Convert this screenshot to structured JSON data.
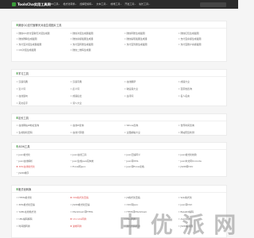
{
  "nav": {
    "logo_text": "ToolsCha实用工具网",
    "menu": [
      "JSON工具",
      "格式化转换",
      "加解密编码",
      "文本工具",
      "前端工具",
      "开发工具",
      "站长工具"
    ]
  },
  "sections": [
    {
      "title": "微信QQ支付宝聊天对话生成图片工具",
      "items": [
        "微信QQ支付宝聊天对话生成器",
        "微信对话生成器截图",
        "微信转账生成截图",
        "微信红包生成截图",
        "微信群聊生成截图",
        "微信余额截图生成器",
        "微信提现截图生成器",
        "支付宝余额生成截图",
        "支付宝对话生成器截图",
        "支付宝转账生成截图",
        "支付宝到账生成截图",
        "支付宝账户余额截图",
        "QQ对话生成截图",
        "微信二维码生成器"
      ]
    },
    {
      "title": "学习工具",
      "items": [
        "汉语词典",
        "汉语字典",
        "在线翻译",
        "成语大全",
        "近义词",
        "反义词",
        "歇后语大全",
        "百家姓查询",
        "在线造句",
        "成语接龙",
        "古诗词",
        "名人名言",
        "英文名字",
        "诗人大全"
      ]
    },
    {
      "title": "站长工具",
      "items": [
        "在线网站IP地址查询",
        "在线IP查询",
        "Whois查询",
        "世界时间查询",
        "生成随机密码",
        "在线计算器",
        "全国邮编大全",
        "网站死链检测"
      ]
    },
    {
      "title": "JSON工具",
      "items": [
        "Json格式化",
        "Json在线工具",
        "Json压缩转义",
        "Json格式化校验",
        "Json在线解析",
        "Json生成Java实体类",
        "Json转XML",
        "Json中文转Unicode",
        "XML在线格式化",
        "Excel转Json",
        "Json转Excel表格",
        "JSON转CSV",
        "JSON排序"
      ],
      "hot_index": [
        8
      ]
    },
    {
      "title": "格式化转换",
      "items": [
        "HTML格式化",
        "CSS格式化压缩",
        "JS格式化压缩",
        "SQL格式化",
        "XML格式化压缩",
        "JSON格式化压缩",
        "CSV转Json",
        "Json转CSV",
        "YAML在线格式化",
        "Markdown转HTML",
        "HTML转Markdown",
        "Base64编码",
        "URL编码解码",
        "Unicode转换",
        "Hex转换",
        "Ascii转换",
        "时间戳转换",
        "进制转换",
        "颜色代码转换",
        "JSON编辑器"
      ],
      "hot_index": [
        1,
        13,
        17
      ]
    }
  ],
  "watermark": "中 优 派 网"
}
